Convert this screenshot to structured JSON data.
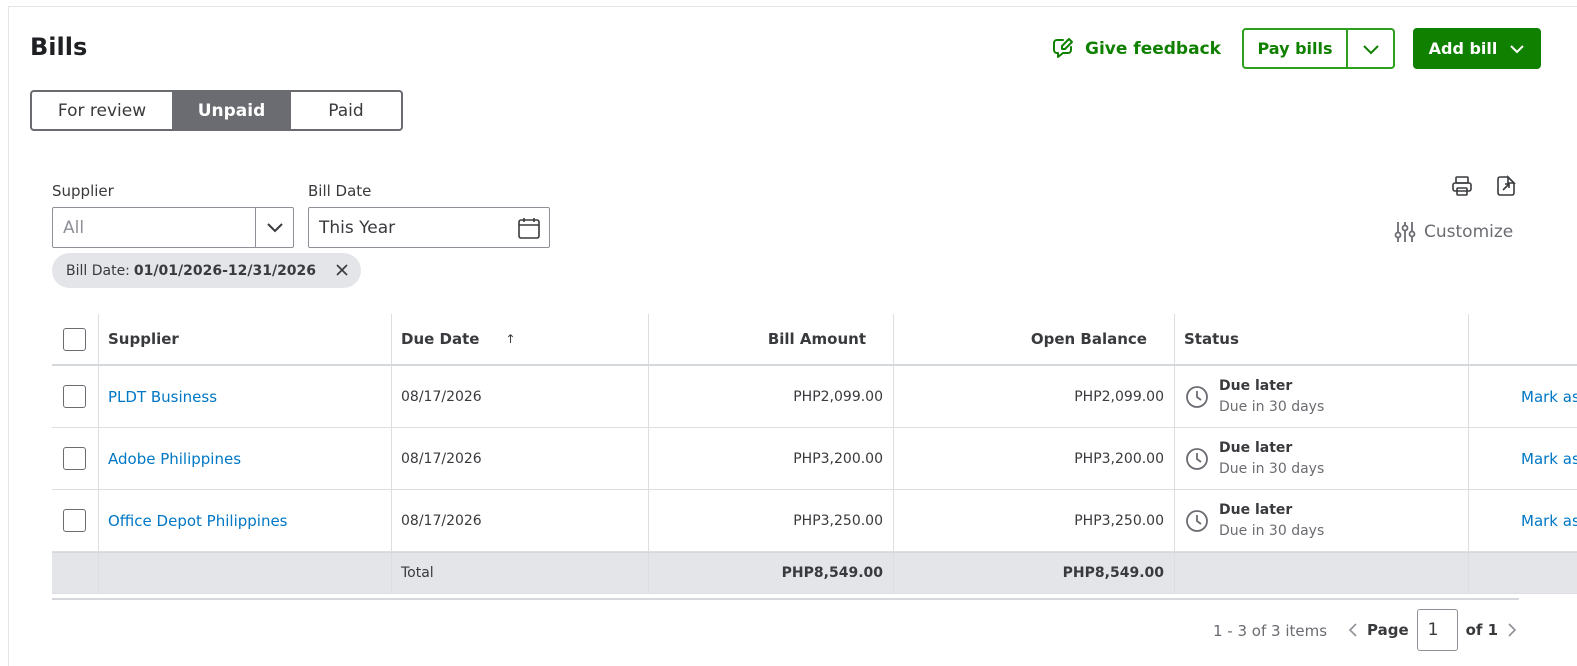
{
  "header": {
    "title": "Bills",
    "feedback_label": "Give feedback",
    "pay_bills_label": "Pay bills",
    "add_bill_label": "Add bill"
  },
  "tabs": [
    {
      "label": "For review",
      "active": false
    },
    {
      "label": "Unpaid",
      "active": true
    },
    {
      "label": "Paid",
      "active": false
    }
  ],
  "filters": {
    "supplier_label": "Supplier",
    "supplier_value": "All",
    "bill_date_label": "Bill Date",
    "bill_date_value": "This Year",
    "chip_prefix": "Bill Date:",
    "chip_value": "01/01/2026-12/31/2026"
  },
  "toolbar": {
    "customize_label": "Customize"
  },
  "table": {
    "columns": [
      "Supplier",
      "Due Date",
      "Bill Amount",
      "Open Balance",
      "Status"
    ],
    "sort_indicator": "↑",
    "rows": [
      {
        "supplier": "PLDT Business",
        "due_date": "08/17/2026",
        "bill_amount": "PHP2,099.00",
        "open_balance": "PHP2,099.00",
        "status": "Due later",
        "status_sub": "Due in 30 days",
        "action": "Mark as paid"
      },
      {
        "supplier": "Adobe Philippines",
        "due_date": "08/17/2026",
        "bill_amount": "PHP3,200.00",
        "open_balance": "PHP3,200.00",
        "status": "Due later",
        "status_sub": "Due in 30 days",
        "action": "Mark as paid"
      },
      {
        "supplier": "Office Depot Philippines",
        "due_date": "08/17/2026",
        "bill_amount": "PHP3,250.00",
        "open_balance": "PHP3,250.00",
        "status": "Due later",
        "status_sub": "Due in 30 days",
        "action": "Mark as paid"
      }
    ],
    "total_label": "Total",
    "total_bill_amount": "PHP8,549.00",
    "total_open_balance": "PHP8,549.00"
  },
  "pagination": {
    "items_label": "1 - 3 of 3 items",
    "page_label": "Page",
    "page_value": "1",
    "of_label": "of 1"
  },
  "colors": {
    "brand_green": "#108000",
    "link_blue": "#0077c5",
    "tab_active": "#6b6c72"
  }
}
